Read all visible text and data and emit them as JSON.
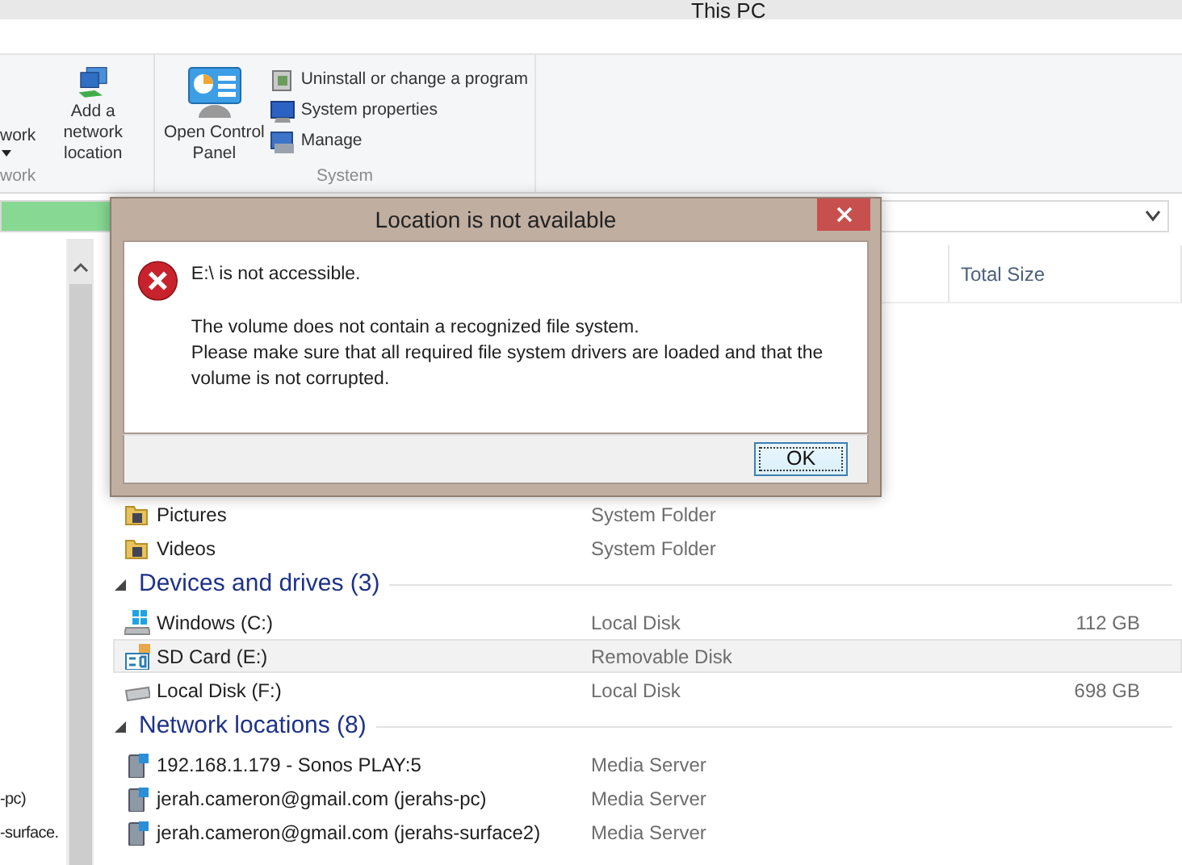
{
  "window": {
    "title": "This PC"
  },
  "ribbon": {
    "groups": [
      {
        "label": "work",
        "large_buttons": [
          {
            "label": "work",
            "kind": "dropdown"
          },
          {
            "label": "Add a network location",
            "kind": "network"
          }
        ]
      },
      {
        "label": "System",
        "large_buttons": [
          {
            "label": "Open Control Panel",
            "kind": "control-panel"
          }
        ],
        "small_buttons": [
          {
            "label": "Uninstall or change a program",
            "kind": "uninstall"
          },
          {
            "label": "System properties",
            "kind": "properties"
          },
          {
            "label": "Manage",
            "kind": "manage"
          }
        ]
      }
    ]
  },
  "address_bar": {
    "level": 0.1
  },
  "nav_pane": {
    "items": [
      {
        "label": "-pc)"
      },
      {
        "label": "-surface."
      }
    ]
  },
  "columns": [
    {
      "label": "Total Size"
    }
  ],
  "sections": [
    {
      "items": [
        {
          "name": "Pictures",
          "type": "System Folder",
          "kind": "folder",
          "selected": false
        },
        {
          "name": "Videos",
          "type": "System Folder",
          "kind": "folder",
          "selected": false
        }
      ]
    },
    {
      "title": "Devices and drives (3)",
      "expanded": true,
      "items": [
        {
          "name": "Windows (C:)",
          "type": "Local Disk",
          "size": "112 GB",
          "kind": "windows-drive",
          "selected": false
        },
        {
          "name": "SD Card (E:)",
          "type": "Removable Disk",
          "kind": "sd",
          "selected": true
        },
        {
          "name": "Local Disk (F:)",
          "type": "Local Disk",
          "size": "698 GB",
          "kind": "drive",
          "selected": false
        }
      ]
    },
    {
      "title": "Network locations (8)",
      "expanded": true,
      "items": [
        {
          "name": "192.168.1.179 - Sonos PLAY:5",
          "type": "Media Server",
          "kind": "server",
          "selected": false
        },
        {
          "name": "jerah.cameron@gmail.com (jerahs-pc)",
          "type": "Media Server",
          "kind": "server",
          "selected": false
        },
        {
          "name": "jerah.cameron@gmail.com (jerahs-surface2)",
          "type": "Media Server",
          "kind": "server",
          "selected": false
        }
      ]
    }
  ],
  "dialog": {
    "title": "Location is not available",
    "heading": "E:\\ is not accessible.",
    "lines": [
      "The volume does not contain a recognized file system.",
      "Please make sure that all required file system drivers are loaded and that the volume is not corrupted."
    ],
    "button": "OK"
  }
}
